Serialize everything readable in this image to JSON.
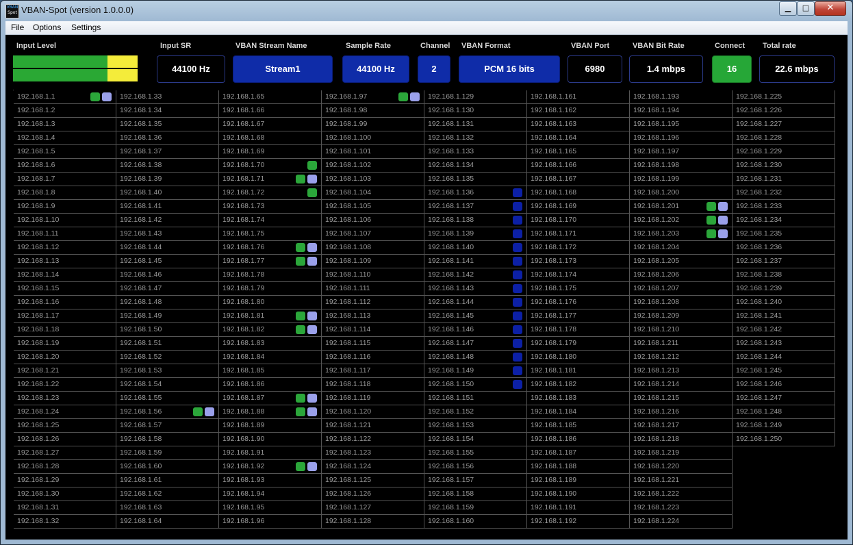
{
  "window": {
    "title": "VBAN-Spot (version 1.0.0.0)",
    "icon_text_top": "VBAN",
    "icon_text_bottom": "Spot",
    "controls": {
      "minimize": "▁",
      "maximize": "□",
      "close": "✕"
    }
  },
  "menu": [
    {
      "label": "File"
    },
    {
      "label": "Options"
    },
    {
      "label": "Settings"
    }
  ],
  "header": {
    "input_level": {
      "label": "Input Level",
      "level_fraction": 0.76
    },
    "input_sr": {
      "label": "Input SR",
      "value": "44100 Hz"
    },
    "stream_name": {
      "label": "VBAN Stream Name",
      "value": "Stream1"
    },
    "sample_rate": {
      "label": "Sample Rate",
      "value": "44100 Hz"
    },
    "channel": {
      "label": "Channel",
      "value": "2"
    },
    "format": {
      "label": "VBAN Format",
      "value": "PCM 16 bits"
    },
    "port": {
      "label": "VBAN Port",
      "value": "6980"
    },
    "bit_rate": {
      "label": "VBAN Bit Rate",
      "value": "1.4 mbps"
    },
    "connect": {
      "label": "Connect",
      "value": "16"
    },
    "total_rate": {
      "label": "Total rate",
      "value": "22.6 mbps"
    }
  },
  "colors": {
    "active_green": "#2ba63a",
    "light_blue": "#9aa0ea",
    "dark_blue": "#0c20a6",
    "meter_green": "#2aa834",
    "meter_yellow": "#f4ec3a"
  },
  "grid": {
    "ip_prefix": "192.168.1.",
    "columns": [
      {
        "first": 1,
        "count": 32
      },
      {
        "first": 33,
        "count": 32
      },
      {
        "first": 65,
        "count": 32
      },
      {
        "first": 97,
        "count": 32
      },
      {
        "first": 129,
        "count": 32
      },
      {
        "first": 161,
        "count": 32
      },
      {
        "first": 193,
        "count": 32
      },
      {
        "first": 225,
        "count": 26
      }
    ],
    "indicators": {
      "1": [
        "green",
        "light"
      ],
      "56": [
        "green",
        "light"
      ],
      "70": [
        "green"
      ],
      "71": [
        "green",
        "light"
      ],
      "72": [
        "green"
      ],
      "76": [
        "green",
        "light"
      ],
      "77": [
        "green",
        "light"
      ],
      "81": [
        "green",
        "light"
      ],
      "82": [
        "green",
        "light"
      ],
      "87": [
        "green",
        "light"
      ],
      "88": [
        "green",
        "light"
      ],
      "92": [
        "green",
        "light"
      ],
      "97": [
        "green",
        "light"
      ],
      "136": [
        "dark"
      ],
      "137": [
        "dark"
      ],
      "138": [
        "dark"
      ],
      "139": [
        "dark"
      ],
      "140": [
        "dark"
      ],
      "141": [
        "dark"
      ],
      "142": [
        "dark"
      ],
      "143": [
        "dark"
      ],
      "144": [
        "dark"
      ],
      "145": [
        "dark"
      ],
      "146": [
        "dark"
      ],
      "147": [
        "dark"
      ],
      "148": [
        "dark"
      ],
      "149": [
        "dark"
      ],
      "150": [
        "dark"
      ],
      "201": [
        "green",
        "light"
      ],
      "202": [
        "green",
        "light"
      ],
      "203": [
        "green",
        "light"
      ]
    }
  }
}
